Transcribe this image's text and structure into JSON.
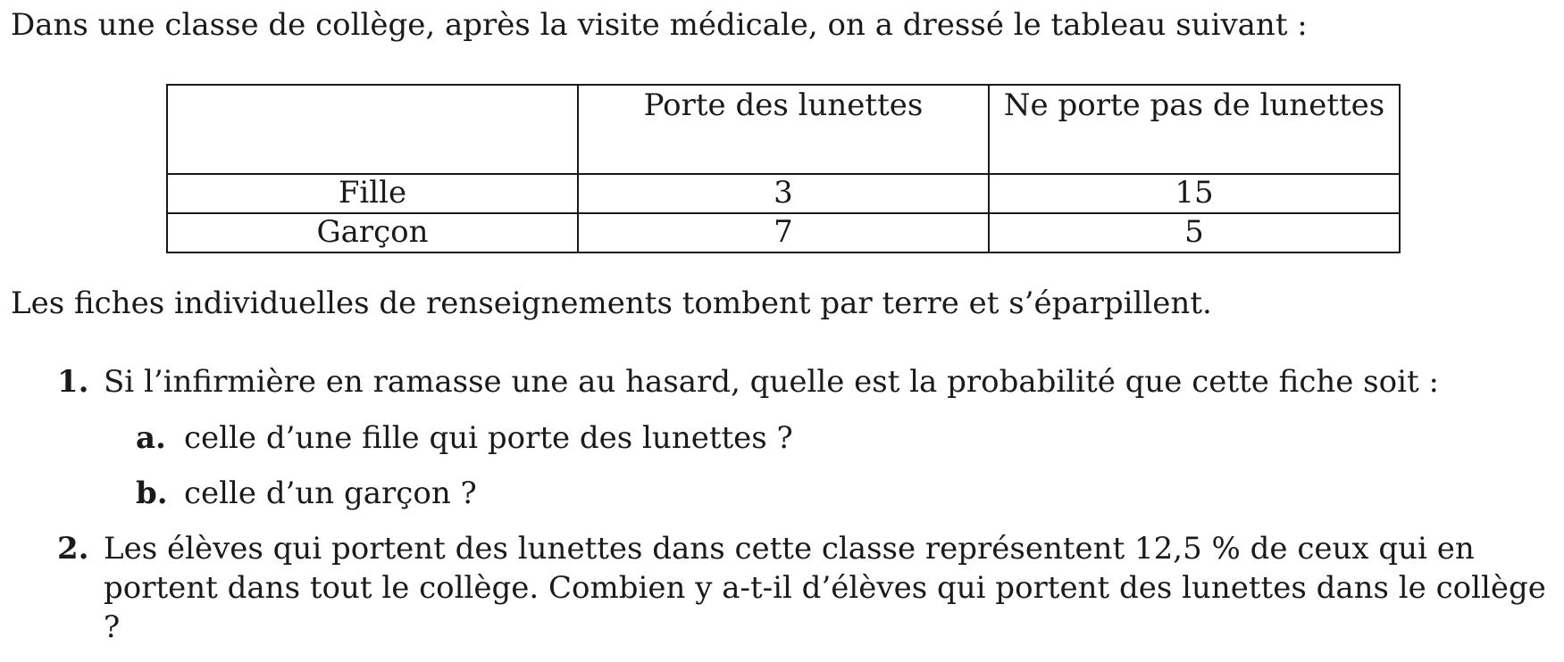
{
  "intro": "Dans une classe de collège, après la visite médicale, on a dressé le tableau suivant :",
  "table": {
    "headers": [
      "",
      "Porte des lunettes",
      "Ne porte pas de lunettes"
    ],
    "rows": [
      [
        "Fille",
        "3",
        "15"
      ],
      [
        "Garçon",
        "7",
        "5"
      ]
    ]
  },
  "outro": "Les fiches individuelles de renseignements tombent par terre et s’éparpillent.",
  "questions": [
    {
      "number": "1.",
      "text": "Si l’infirmière en ramasse une au hasard, quelle est la probabilité que cette fiche soit :",
      "subs": [
        {
          "label": "a.",
          "text": "celle d’une fille qui porte des lunettes ?"
        },
        {
          "label": "b.",
          "text": "celle d’un garçon ?"
        }
      ]
    },
    {
      "number": "2.",
      "text": "Les élèves qui portent des lunettes dans cette classe représentent 12,5 % de ceux qui en portent dans tout le collège. Combien y a-t-il d’élèves qui portent des lunettes dans le collège ?"
    }
  ]
}
